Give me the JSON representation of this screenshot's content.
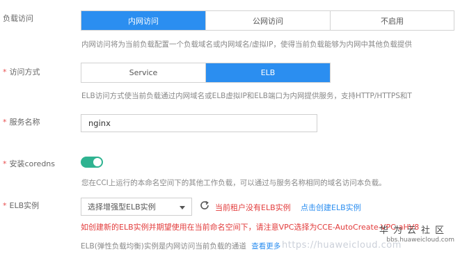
{
  "colors": {
    "accent": "#2b8ef0",
    "required": "#e84d4d",
    "toggle_on": "#2fb391",
    "error": "#e23b3b"
  },
  "load_access": {
    "label": "负载访问",
    "options": [
      "内网访问",
      "公网访问",
      "不启用"
    ],
    "selected": "内网访问",
    "hint": "内网访问将为当前负载配置一个负载域名或内网域名/虚拟IP，使得当前负载能够为内网中其他负载提供"
  },
  "access_mode": {
    "label": "访问方式",
    "options": [
      "Service",
      "ELB"
    ],
    "selected": "ELB",
    "hint": "ELB访问方式使当前负载通过内网域名或ELB虚拟IP和ELB端口为内网提供服务，支持HTTP/HTTPS和T"
  },
  "service_name": {
    "label": "服务名称",
    "value": "nginx"
  },
  "coredns": {
    "label": "安装coredns",
    "enabled": true,
    "hint": "您在CCI上运行的本命名空间下的其他工作负载，可以通过与服务名称相同的域名访问本负载。"
  },
  "elb_instance": {
    "label": "ELB实例",
    "select_placeholder": "选择增强型ELB实例",
    "refresh_icon": "refresh-icon",
    "no_instance_text": "当前租户没有ELB实例",
    "create_link": "点击创建ELB实例",
    "error_text": "如创建新的ELB实例并期望使用在当前命名空间下，请注意VPC选择为CCE-AutoCreate-VPC-aHV8",
    "footer_hint": "ELB(弹性负载均衡)实例是内网访问当前负载的通道",
    "footer_link": "查看更多"
  },
  "watermark": {
    "brand": "华为云社区",
    "url_small": "bbs.huaweicloud.com",
    "url_overlay": "https://huaweicloud.com"
  }
}
